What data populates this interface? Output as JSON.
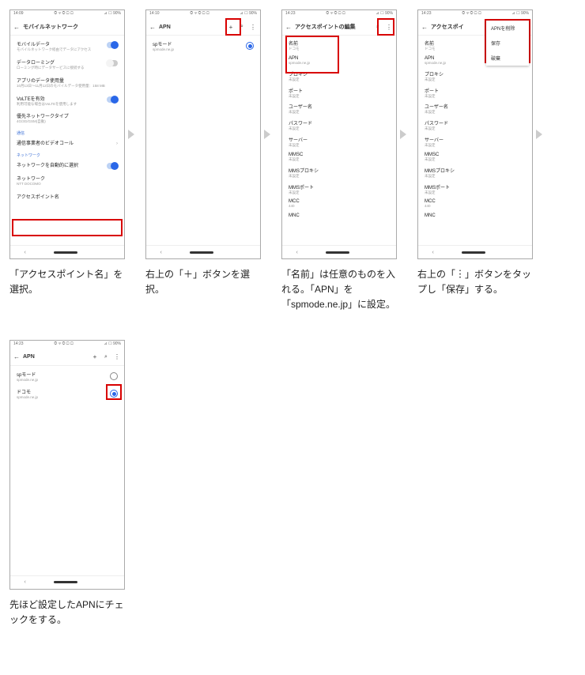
{
  "status": {
    "time1": "14:09",
    "time2": "14:10",
    "time3": "14:23",
    "lefticons": "◎ ፨ ◎ ▢ ▢",
    "right": "⊿ ☐ 90%"
  },
  "screen1": {
    "title": "モバイルネットワーク",
    "items": [
      {
        "label": "モバイルデータ",
        "sub": "モバイルネットワーク経由でデータにアクセス",
        "toggle": true
      },
      {
        "label": "データローミング",
        "sub": "ローミング時にデータサービスに接続する",
        "toggle": false
      },
      {
        "label": "アプリのデータ使用量",
        "sub": "10月13日〜11月12日のモバイルデータ使用量：158 MB"
      },
      {
        "label": "VoLTEを有効",
        "sub": "利用可能な場合はVoLTEを使用します",
        "toggle": true
      },
      {
        "label": "優先ネットワークタイプ",
        "sub": "4G/3G/GSM(自動)"
      }
    ],
    "section_tsushin": "通信",
    "video_call": "通信事業者のビデオコール",
    "section_network": "ネットワーク",
    "auto_net": {
      "label": "ネットワークを自動的に選択",
      "toggle": true
    },
    "net_gray": {
      "label": "ネットワーク",
      "sub": "NTT DOCOMO"
    },
    "apn": "アクセスポイント名"
  },
  "screen2": {
    "title": "APN",
    "item": {
      "label": "spモード",
      "sub": "spmode.ne.jp"
    }
  },
  "screen3": {
    "title": "アクセスポイントの編集",
    "fields": [
      {
        "label": "名前",
        "val": "ドコモ"
      },
      {
        "label": "APN",
        "val": "spmode.ne.jp"
      },
      {
        "label": "プロキシ",
        "val": "未設定"
      },
      {
        "label": "ポート",
        "val": "未設定"
      },
      {
        "label": "ユーザー名",
        "val": "未設定"
      },
      {
        "label": "パスワード",
        "val": "未設定"
      },
      {
        "label": "サーバー",
        "val": "未設定"
      },
      {
        "label": "MMSC",
        "val": "未設定"
      },
      {
        "label": "MMSプロキシ",
        "val": "未設定"
      },
      {
        "label": "MMSポート",
        "val": "未設定"
      },
      {
        "label": "MCC",
        "val": "440"
      },
      {
        "label": "MNC",
        "val": ""
      }
    ]
  },
  "screen4": {
    "title": "アクセスポイ",
    "menu": [
      "APNを削除",
      "保存",
      "破棄"
    ]
  },
  "screen5": {
    "title": "APN",
    "items": [
      {
        "label": "spモード",
        "sub": "spmode.ne.jp",
        "sel": false
      },
      {
        "label": "ドコモ",
        "sub": "spmode.ne.jp",
        "sel": true
      }
    ]
  },
  "captions": [
    "「アクセスポイント名」を選択。",
    "右上の「＋」ボタンを選択。",
    "「名前」は任意のものを入れる。「APN」を「spmode.ne.jp」に設定。",
    "右上の「︙」ボタンをタップし「保存」する。",
    "先ほど設定したAPNにチェックをする。"
  ]
}
